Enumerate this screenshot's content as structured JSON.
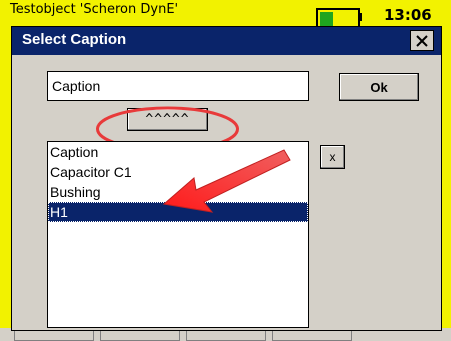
{
  "app": {
    "title": "Testobject 'Scheron DynE'",
    "clock": "13:06"
  },
  "dialog": {
    "title": "Select Caption",
    "close_label": "×",
    "caption_input_value": "Caption",
    "ok_label": "Ok",
    "keyboard_label": "^^^^^",
    "clear_label": "x",
    "list_items": [
      "Caption",
      "Capacitor C1",
      "Bushing",
      "H1"
    ],
    "selected_index": 3
  },
  "colors": {
    "title_bar": "#0a246a",
    "app_bar": "#f2f200",
    "annotation": "#e83a3a",
    "dialog_face": "#d4d0c8"
  },
  "icons": {
    "close": "close-icon",
    "annotation_arrow": "red-arrow-icon",
    "annotation_circle": "red-ellipse-highlight"
  }
}
